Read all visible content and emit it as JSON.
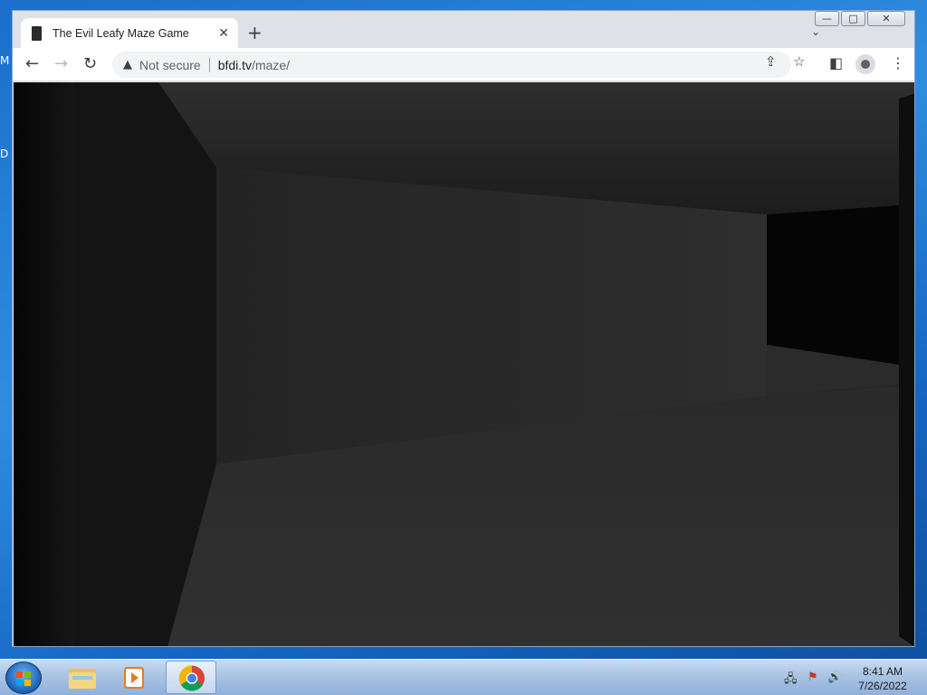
{
  "desktop": {
    "fragment_1": "M",
    "fragment_2": "D"
  },
  "window_controls": {
    "minimize": "—",
    "maximize": "□",
    "close": "✕"
  },
  "tab": {
    "title": "The Evil Leafy Maze Game",
    "close": "✕"
  },
  "new_tab": "+",
  "tab_search": "⌄",
  "toolbar": {
    "back": "←",
    "forward": "→",
    "reload": "↻",
    "security_icon": "▲",
    "security_label": "Not secure",
    "url_host": "bfdi.tv",
    "url_path": "/maze/",
    "share": "⇪",
    "bookmark": "☆",
    "side_panel": "◧",
    "menu": "⋮"
  },
  "game": {
    "name": "3d-maze-view",
    "colors": {
      "left_near_wall": "#0d0d0d",
      "left_wall_face": "#151515",
      "ceiling": "#2e2e2e",
      "far_wall": "#2a2a2a",
      "floor": "#2d2d2d",
      "right_opening": "#050505",
      "right_edge_wall": "#111111"
    }
  },
  "taskbar": {
    "clock_time": "8:41 AM",
    "clock_date": "7/26/2022",
    "apps": [
      "file-explorer",
      "media-player",
      "chrome"
    ],
    "tray": {
      "network": "🖧",
      "flag": "⚑",
      "volume": "🔊"
    }
  }
}
